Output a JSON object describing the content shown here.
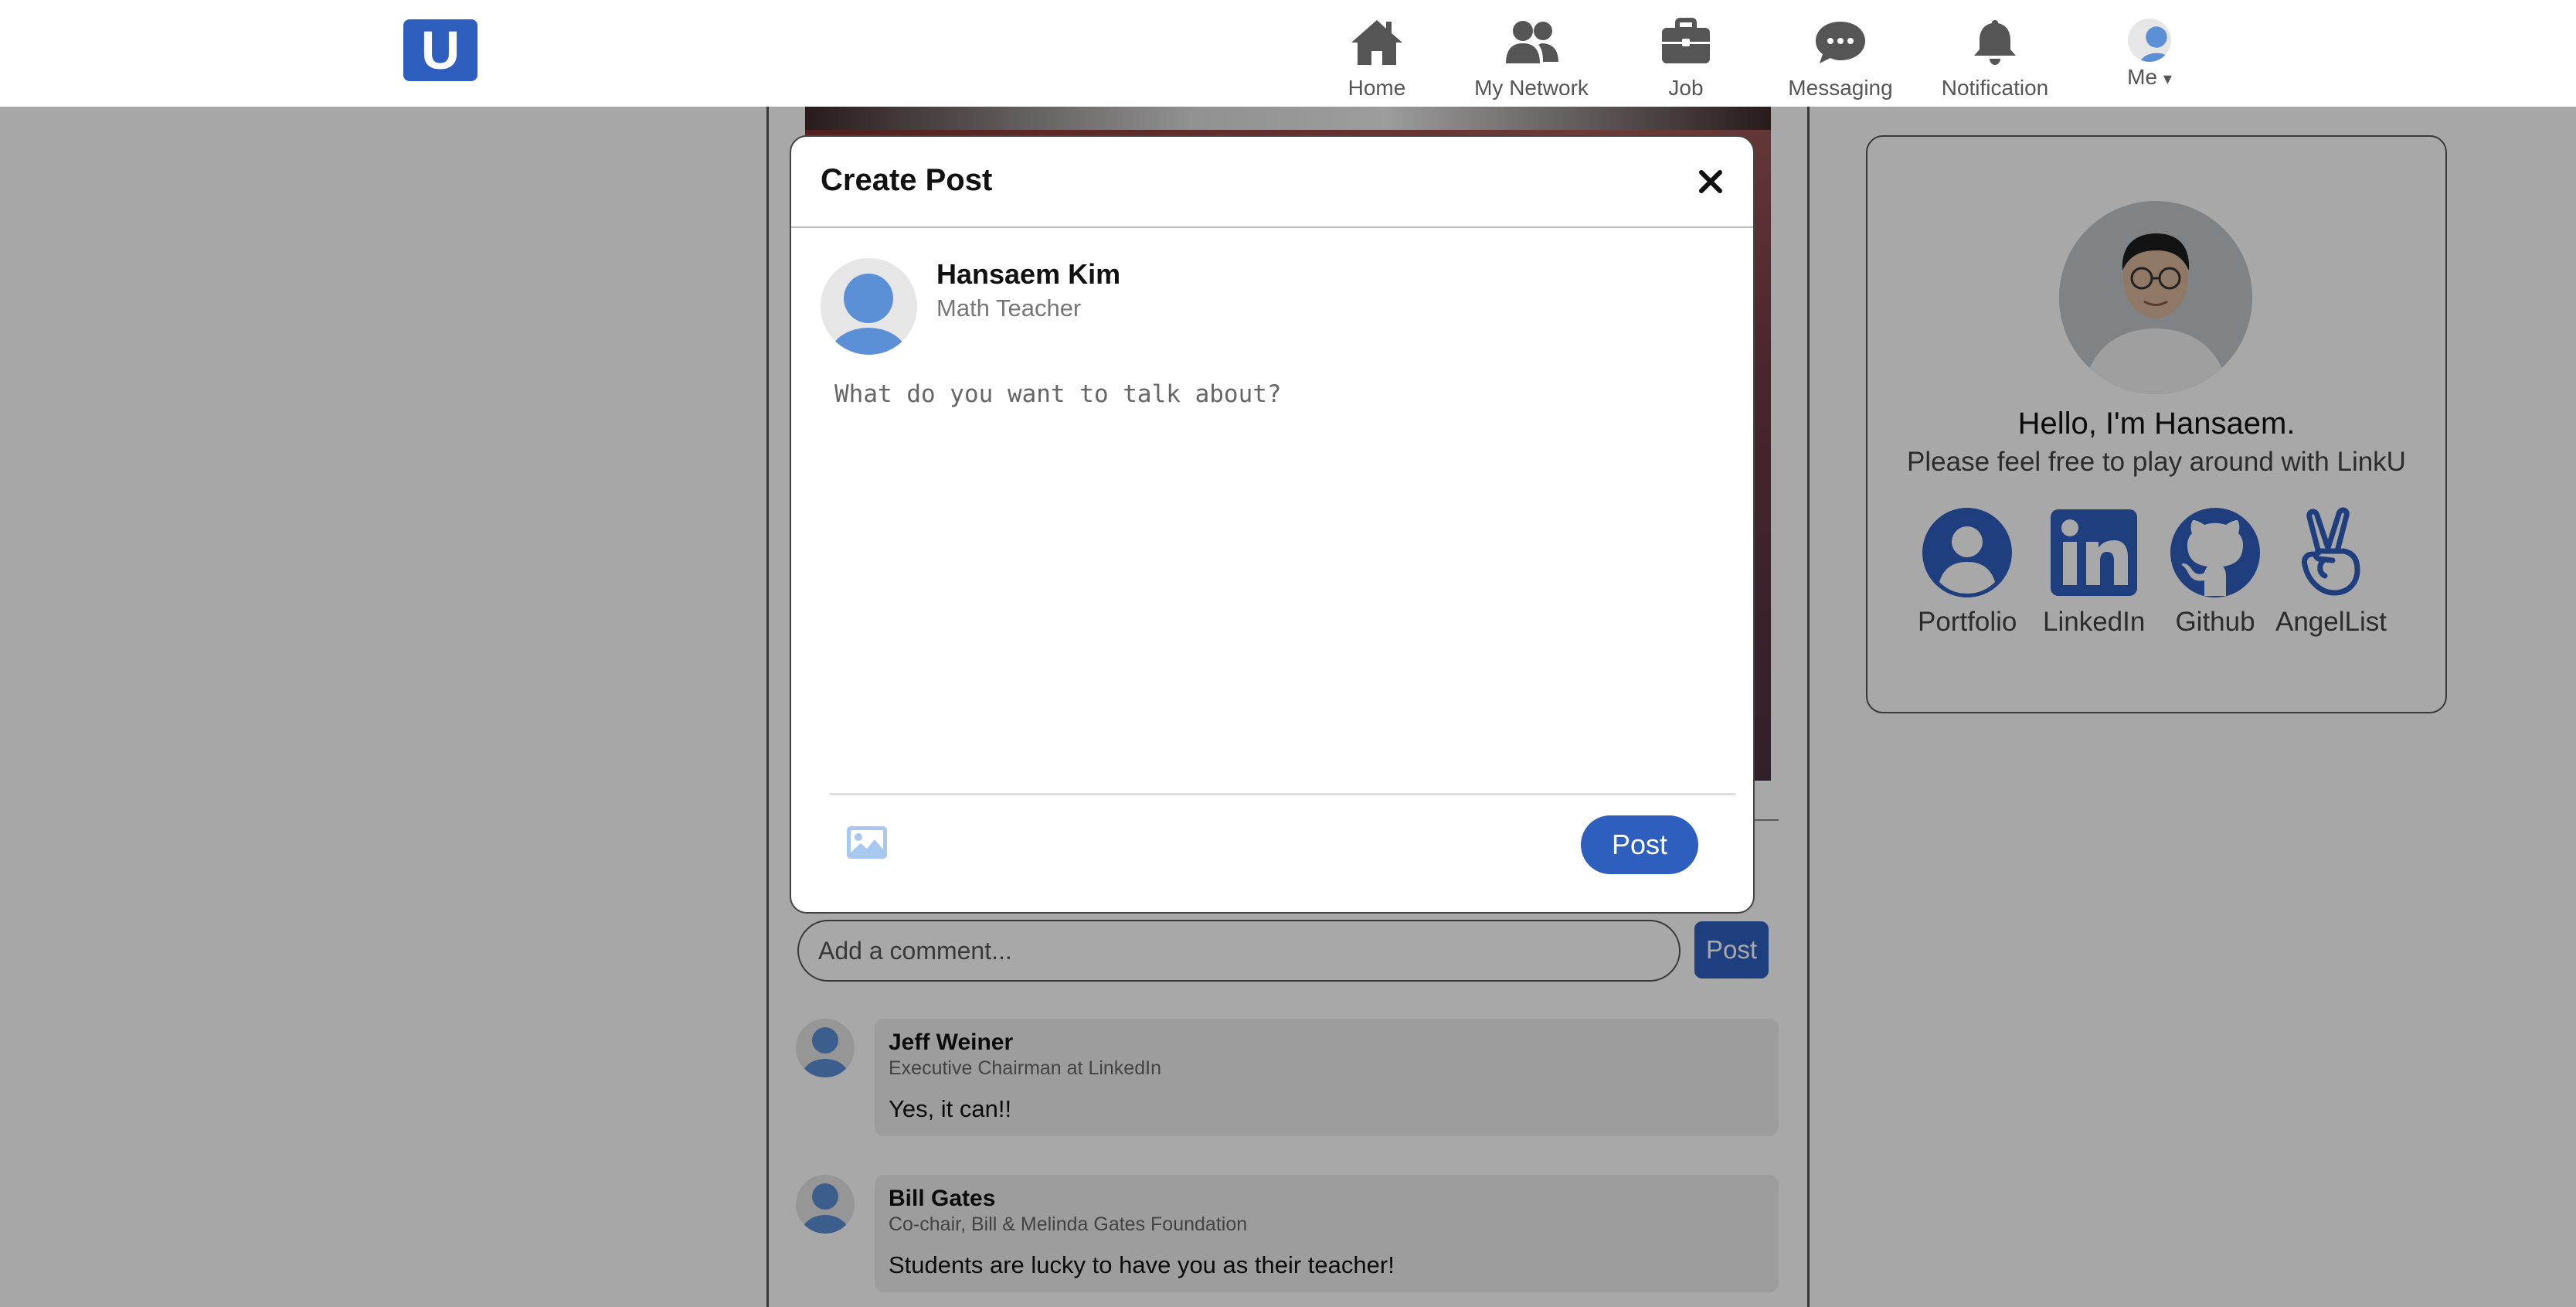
{
  "header": {
    "logo_letter": "U",
    "nav": [
      {
        "label": "Home",
        "icon": "home-icon"
      },
      {
        "label": "My Network",
        "icon": "network-icon"
      },
      {
        "label": "Job",
        "icon": "briefcase-icon"
      },
      {
        "label": "Messaging",
        "icon": "chat-icon"
      },
      {
        "label": "Notification",
        "icon": "bell-icon"
      }
    ],
    "me_label": "Me",
    "me_caret": "▾"
  },
  "feed": {
    "comment_placeholder": "Add a comment...",
    "comment_post_label": "Post",
    "comments": [
      {
        "name": "Jeff Weiner",
        "title": "Executive Chairman at LinkedIn",
        "text": "Yes, it can!!"
      },
      {
        "name": "Bill Gates",
        "title": "Co-chair, Bill & Melinda Gates Foundation",
        "text": "Students are lucky to have you as their teacher!"
      }
    ]
  },
  "sidebar": {
    "greeting": "Hello, I'm Hansaem.",
    "subtext": "Please feel free to play around with LinkU",
    "links": [
      {
        "label": "Portfolio",
        "icon": "person-circle-icon"
      },
      {
        "label": "LinkedIn",
        "icon": "linkedin-icon"
      },
      {
        "label": "Github",
        "icon": "github-icon"
      },
      {
        "label": "AngelList",
        "icon": "angellist-icon"
      }
    ]
  },
  "modal": {
    "title": "Create Post",
    "close_glyph": "✕",
    "author_name": "Hansaem Kim",
    "author_title": "Math Teacher",
    "placeholder": "What do you want to talk about?",
    "post_label": "Post"
  },
  "colors": {
    "brand": "#2f5fbe",
    "avatar_blue": "#5b8fd6",
    "overlay": "rgba(0,0,0,0.34)"
  }
}
